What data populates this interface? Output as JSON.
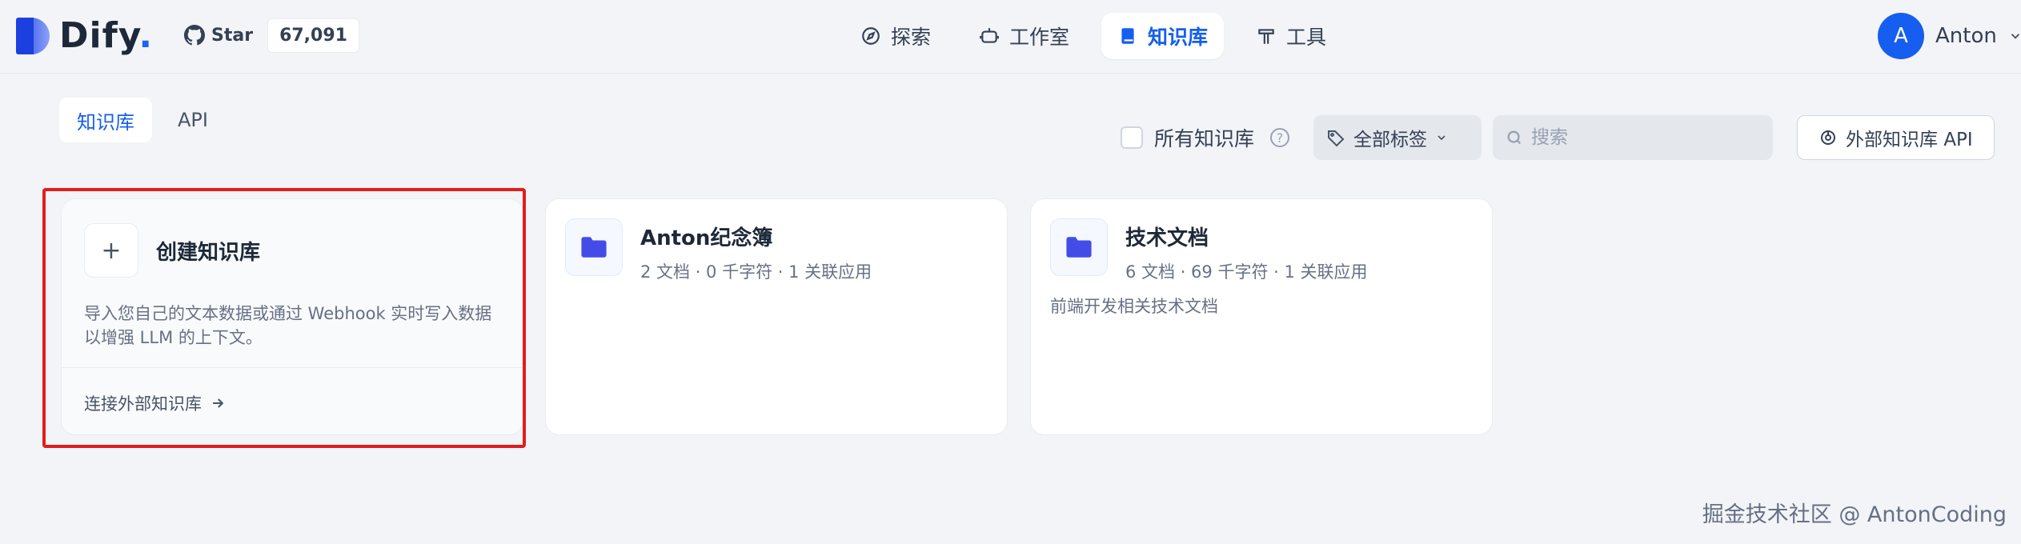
{
  "brand": {
    "name": "Dify",
    "dot": "."
  },
  "github": {
    "star_label": "Star",
    "star_count": "67,091"
  },
  "nav": {
    "items": [
      {
        "label": "探索",
        "icon": "compass-icon"
      },
      {
        "label": "工作室",
        "icon": "robot-icon"
      },
      {
        "label": "知识库",
        "icon": "book-icon",
        "active": true
      },
      {
        "label": "工具",
        "icon": "hammer-icon"
      }
    ]
  },
  "user": {
    "initial": "A",
    "name": "Anton"
  },
  "tabs": [
    {
      "label": "知识库",
      "active": true
    },
    {
      "label": "API",
      "active": false
    }
  ],
  "toolbar": {
    "all_kb_label": "所有知识库",
    "all_kb_checked": false,
    "help": "?",
    "tag_select": "全部标签",
    "search_placeholder": "搜索",
    "external_api_label": "外部知识库 API"
  },
  "create_card": {
    "title": "创建知识库",
    "description": "导入您自己的文本数据或通过 Webhook 实时写入数据以增强 LLM 的上下文。",
    "link": "连接外部知识库"
  },
  "datasets": [
    {
      "name": "Anton纪念簿",
      "meta": "2 文档 · 0 千字符 · 1 关联应用",
      "description": ""
    },
    {
      "name": "技术文档",
      "meta": "6 文档 · 69 千字符 · 1 关联应用",
      "description": "前端开发相关技术文档"
    }
  ],
  "watermark": "掘金技术社区 @ AntonCoding",
  "colors": {
    "accent": "#155eef",
    "highlight": "#e11d1d",
    "folder": "#444ce7"
  }
}
